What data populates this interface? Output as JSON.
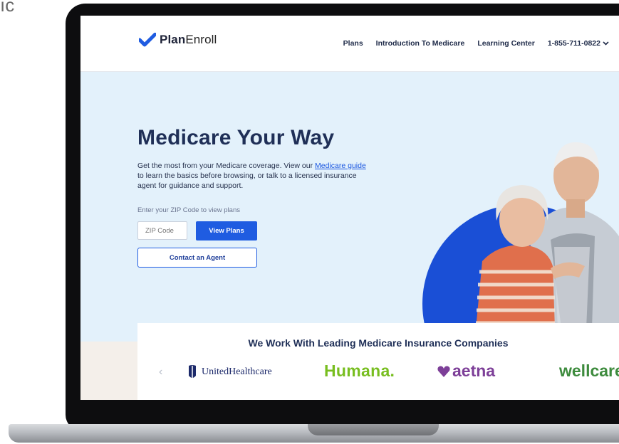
{
  "corner_text": "ıc",
  "header": {
    "logo_bold": "Plan",
    "logo_light": "Enroll",
    "nav": [
      "Plans",
      "Introduction To Medicare",
      "Learning Center"
    ],
    "phone": "1-855-711-0822"
  },
  "hero": {
    "title": "Medicare Your Way",
    "desc_before": "Get the most from your Medicare coverage. View our ",
    "desc_link": "Medicare guide",
    "desc_after": " to learn the basics before browsing, or talk to a licensed insurance agent for guidance and support.",
    "zip_label": "Enter your ZIP Code to view plans",
    "zip_placeholder": "ZIP Code",
    "view_button": "View Plans",
    "agent_button": "Contact an Agent"
  },
  "partners": {
    "title": "We Work With Leading Medicare Insurance Companies",
    "logos": [
      "UnitedHealthcare",
      "Humana.",
      "aetna",
      "wellcare"
    ]
  },
  "colors": {
    "brand_blue": "#1f5ce1",
    "hero_bg": "#e3f1fb",
    "navy": "#1f2f57",
    "humana_green": "#78be20",
    "aetna_purple": "#7d3f98",
    "wellcare_green": "#3d8b3d"
  }
}
